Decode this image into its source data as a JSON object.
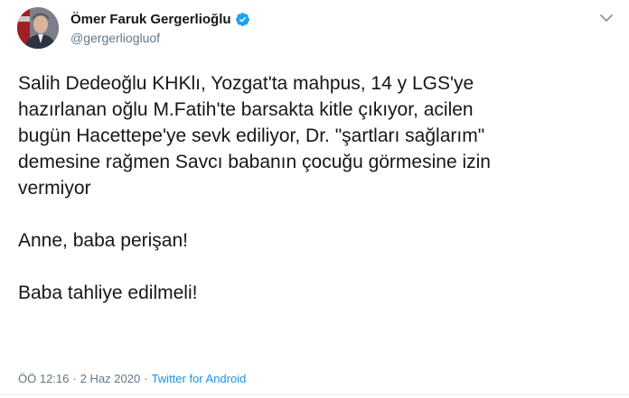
{
  "author": {
    "display_name": "Ömer Faruk Gergerlioğlu",
    "handle": "@gergerliogluof",
    "verified": true,
    "verified_color": "#1da1f2",
    "avatar_icon": "profile-photo"
  },
  "menu": {
    "icon": "chevron-down-icon"
  },
  "tweet": {
    "paragraph_1": "Salih Dedeoğlu KHKlı, Yozgat'ta mahpus, 14 y LGS'ye\nhazırlanan oğlu M.Fatih'te barsakta kitle çıkıyor, acilen\nbugün Hacettepe'ye sevk ediliyor, Dr. \"şartları sağlarım\"\ndemesine rağmen Savcı babanın çocuğu görmesine izin\nvermiyor",
    "paragraph_2": "Anne, baba perişan!",
    "paragraph_3": "Baba tahliye edilmeli!"
  },
  "meta": {
    "time": "ÖÖ 12:16",
    "separator": "·",
    "date": "2 Haz 2020",
    "source": "Twitter for Android",
    "source_color": "#1b95e0"
  }
}
